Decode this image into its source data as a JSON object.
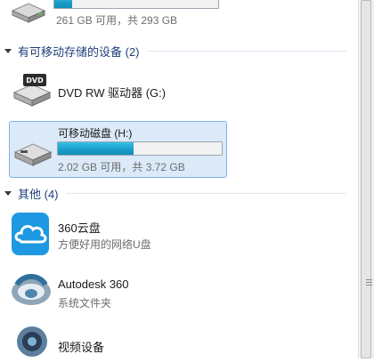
{
  "drive_c": {
    "usage_text": "261 GB 可用，共 293 GB",
    "usage_fraction": 0.11
  },
  "removable_group": {
    "title": "有可移动存储的设备 (2)",
    "items": [
      {
        "name": "DVD RW 驱动器 (G:)",
        "icon": "dvd-drive-icon"
      },
      {
        "name": "可移动磁盘 (H:)",
        "icon": "usb-drive-icon",
        "usage_text": "2.02 GB 可用，共 3.72 GB",
        "usage_fraction": 0.46
      }
    ]
  },
  "other_group": {
    "title": "其他 (4)",
    "items": [
      {
        "name": "360云盘",
        "subtitle": "方便好用的网络U盘",
        "icon": "cloud-icon"
      },
      {
        "name": "Autodesk 360",
        "subtitle": "系统文件夹",
        "icon": "autodesk-360-icon"
      },
      {
        "name": "视频设备",
        "icon": "webcam-icon"
      }
    ]
  },
  "colors": {
    "accent": "#1e3f7a",
    "selection": "#dbe9f8",
    "usage_bar": "#26a9d9"
  }
}
